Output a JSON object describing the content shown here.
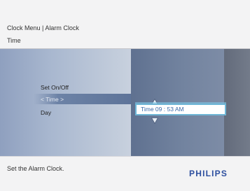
{
  "header": {
    "breadcrumb": "Clock Menu | Alarm Clock",
    "section_title": "Time"
  },
  "menu": {
    "items": [
      {
        "label": "Set On/Off",
        "selected": false
      },
      {
        "label": "< Time >",
        "selected": true
      },
      {
        "label": "Day",
        "selected": false
      }
    ]
  },
  "time_editor": {
    "value": "Time 09 : 53  AM",
    "up_arrow_icon": "triangle-up-icon",
    "down_arrow_icon": "triangle-down-icon"
  },
  "footer": {
    "status": "Set the Alarm Clock.",
    "brand": "PHILIPS"
  },
  "colors": {
    "background": "#f3f3f4",
    "panel_left": "#a8b7cf",
    "panel_mid": "#72839f",
    "panel_right": "#737b8a",
    "highlight": "#6c82a6",
    "field_border": "#6fb6d6",
    "time_text": "#3a6aa8",
    "brand": "#2d4f9f"
  }
}
